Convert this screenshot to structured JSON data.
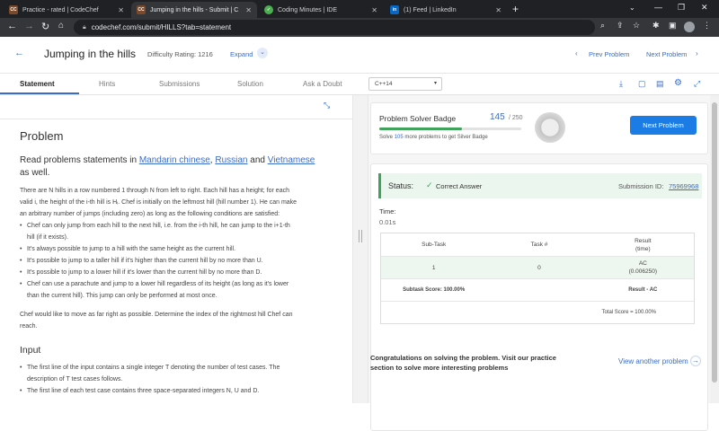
{
  "browser": {
    "tabs": [
      {
        "title": "Practice - rated | CodeChef",
        "favicon": "CC",
        "color": "#7a4a2a"
      },
      {
        "title": "Jumping in the hills - Submit | C",
        "favicon": "CC",
        "color": "#7a4a2a"
      },
      {
        "title": "Coding Minutes | IDE",
        "favicon": "✓",
        "color": "#4caf50"
      },
      {
        "title": "(1) Feed | LinkedIn",
        "favicon": "in",
        "color": "#0a66c2"
      }
    ],
    "new_tab": "+",
    "url": "codechef.com/submit/HILLS?tab=statement"
  },
  "header": {
    "back": "←",
    "title": "Jumping in the hills",
    "difficulty_label": "Difficulty Rating: 1216",
    "expand_label": "Expand",
    "prev_label": "Prev Problem",
    "next_label": "Next Problem"
  },
  "subtabs": {
    "items": [
      "Statement",
      "Hints",
      "Submissions",
      "Solution",
      "Ask a Doubt"
    ],
    "language": "C++14"
  },
  "problem": {
    "heading": "Problem",
    "read_prefix": "Read problems statements in ",
    "lang1": "Mandarin chinese",
    "sep1": ", ",
    "lang2": "Russian",
    "and": " and ",
    "lang3": "Vietnamese",
    "read_suffix": "as well.",
    "intro_lines": [
      "There are N hills in a row numbered 1 through N from left to right. Each hill has a height; for each",
      "valid i, the height of the i-th hill is Hᵢ. Chef is initially on the leftmost hill (hill number 1). He can make",
      "an arbitrary number of jumps (including zero) as long as the following conditions are satisfied:"
    ],
    "rules": [
      "Chef can only jump from each hill to the next hill, i.e. from the i-th hill, he can jump to the i+1-th",
      "hill (if it exists).",
      "It's always possible to jump to a hill with the same height as the current hill.",
      "It's possible to jump to a taller hill if it's higher than the current hill by no more than U.",
      "It's possible to jump to a lower hill if it's lower than the current hill by no more than D.",
      "Chef can use a parachute and jump to a lower hill regardless of its height (as long as it's lower",
      "than the current hill). This jump can only be performed at most once."
    ],
    "outro_lines": [
      "Chef would like to move as far right as possible. Determine the index of the rightmost hill Chef can",
      "reach."
    ],
    "input_heading": "Input",
    "input_items": [
      "The first line of the input contains a single integer T denoting the number of test cases. The",
      "description of T test cases follows.",
      "The first line of each test case contains three space-separated integers N, U and D."
    ]
  },
  "badge": {
    "title": "Problem Solver Badge",
    "count": "145",
    "total": "/ 250",
    "progress_fraction": 0.58,
    "sub_prefix": "Solve ",
    "sub_count": "105",
    "sub_suffix": " more problems to get Silver Badge",
    "button": "Next Problem"
  },
  "status": {
    "label": "Status:",
    "value": "Correct Answer",
    "submission_label": "Submission ID:",
    "submission_id": "75969968",
    "time_label": "Time:",
    "time_value": "0.01s",
    "table": {
      "headers": [
        "Sub-Task",
        "Task #",
        "Result",
        "(time)"
      ],
      "rows": [
        [
          "1",
          "0",
          "AC",
          "(0.006250)"
        ]
      ],
      "subtask_score": "Subtask Score: 100.00%",
      "result": "Result - AC",
      "total": "Total Score = 100.00%"
    }
  },
  "congrats": {
    "line1": "Congratulations on solving the problem. Visit our practice",
    "line2": "section to solve more interesting problems",
    "link": "View another problem"
  },
  "colors": {
    "accent": "#3a6dca",
    "success": "#3fa35b",
    "button": "#1c7ce5"
  }
}
